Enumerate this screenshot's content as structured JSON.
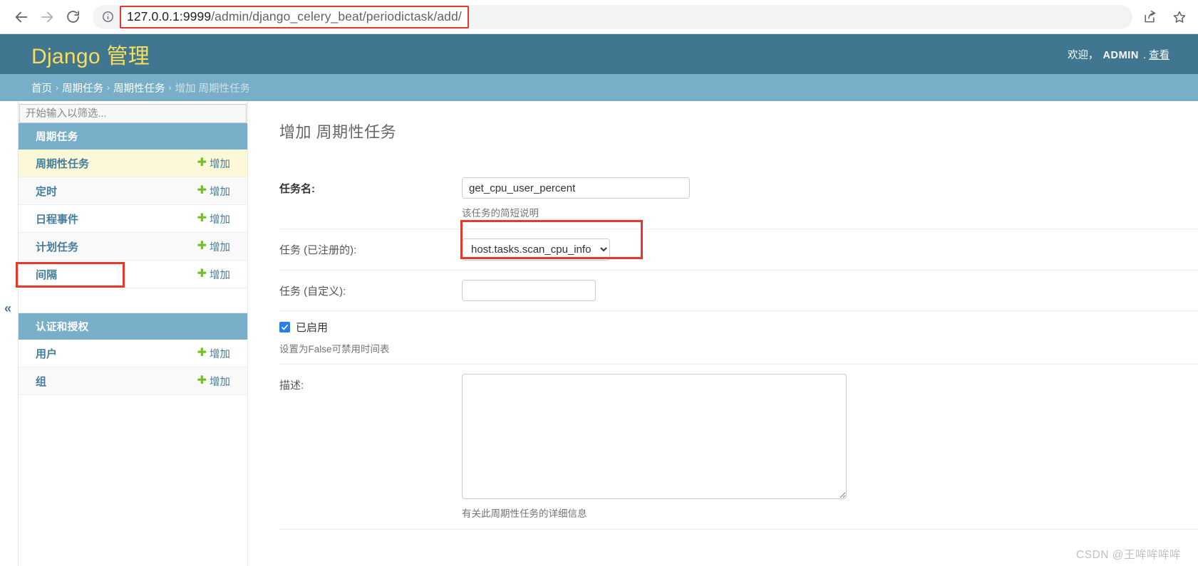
{
  "browser": {
    "back_label": "back",
    "forward_label": "forward",
    "reload_label": "reload",
    "url_host": "127.0.0.1:9999",
    "url_path": "/admin/django_celery_beat/periodictask/add/",
    "url_full": "127.0.0.1:9999/admin/django_celery_beat/periodictask/add/",
    "highlight_color": "#e8372b"
  },
  "header": {
    "brand": "Django 管理",
    "welcome": "欢迎，",
    "username": "ADMIN",
    "separator": ".",
    "link_view_site": "查看",
    "bg_color": "#417690",
    "brand_color": "#f5dd5d"
  },
  "breadcrumbs": {
    "items": [
      {
        "label": "首页",
        "current": false
      },
      {
        "label": "周期任务",
        "current": false
      },
      {
        "label": "周期性任务",
        "current": false
      },
      {
        "label": "增加 周期性任务",
        "current": true
      }
    ],
    "separator": "›",
    "bg_color": "#79aec8"
  },
  "sidebar": {
    "filter_placeholder": "开始输入以筛选...",
    "filter_value": "",
    "collapse_label": "«",
    "add_label": "增加",
    "plus_glyph": "✚",
    "groups": [
      {
        "caption": "周期任务",
        "models": [
          {
            "label": "周期性任务",
            "add": "增加",
            "current": true
          },
          {
            "label": "定时",
            "add": "增加",
            "current": false
          },
          {
            "label": "日程事件",
            "add": "增加",
            "current": false
          },
          {
            "label": "计划任务",
            "add": "增加",
            "current": false
          },
          {
            "label": "间隔",
            "add": "增加",
            "current": false
          }
        ]
      },
      {
        "caption": "认证和授权",
        "models": [
          {
            "label": "用户",
            "add": "增加",
            "current": false
          },
          {
            "label": "组",
            "add": "增加",
            "current": false
          }
        ]
      }
    ]
  },
  "main": {
    "title": "增加 周期性任务",
    "fields": {
      "name": {
        "label": "任务名:",
        "value": "get_cpu_user_percent",
        "placeholder": "",
        "help": "该任务的简短说明"
      },
      "task_registered": {
        "label": "任务 (已注册的):",
        "selected": "host.tasks.scan_cpu_info",
        "options": [
          "host.tasks.scan_cpu_info"
        ],
        "help": ""
      },
      "task_custom": {
        "label": "任务 (自定义):",
        "value": "",
        "placeholder": "",
        "help": ""
      },
      "enabled": {
        "label": "已启用",
        "checked": true,
        "help": "设置为False可禁用时间表"
      },
      "description": {
        "label": "描述:",
        "value": "",
        "help": "有关此周期性任务的详细信息"
      }
    }
  },
  "watermark": {
    "text": "CSDN @王哞哞哞哞"
  }
}
